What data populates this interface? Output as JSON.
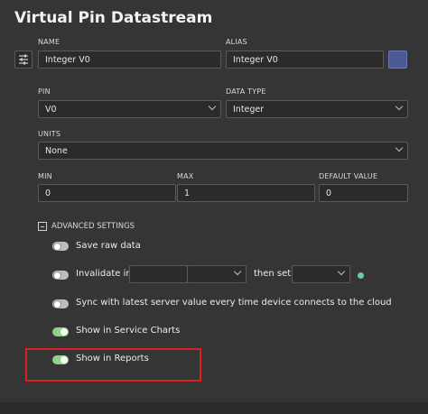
{
  "title": "Virtual Pin Datastream",
  "name": {
    "label": "NAME",
    "value": "Integer V0"
  },
  "alias": {
    "label": "ALIAS",
    "value": "Integer V0"
  },
  "color": "#4a5a94",
  "pin": {
    "label": "PIN",
    "value": "V0"
  },
  "data_type": {
    "label": "DATA TYPE",
    "value": "Integer"
  },
  "units": {
    "label": "UNITS",
    "value": "None"
  },
  "min": {
    "label": "MIN",
    "value": "0"
  },
  "max": {
    "label": "MAX",
    "value": "1"
  },
  "default_value": {
    "label": "DEFAULT VALUE",
    "value": "0"
  },
  "advanced": {
    "label": "ADVANCED SETTINGS",
    "save_raw": {
      "label": "Save raw data",
      "on": false
    },
    "invalidate": {
      "label": "Invalidate in",
      "then_set": "then set",
      "on": false
    },
    "sync": {
      "label": "Sync with latest server value every time device connects to the cloud",
      "on": false
    },
    "service_charts": {
      "label": "Show in Service Charts",
      "on": true
    },
    "reports": {
      "label": "Show in Reports",
      "on": true
    }
  },
  "colors": {
    "toggle_on": "#8fd08a",
    "highlight": "#e01e1e",
    "info": "#6fc7b0"
  }
}
